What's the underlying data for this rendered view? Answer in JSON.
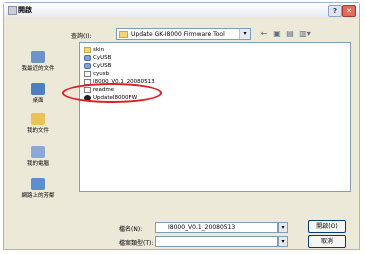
{
  "window": {
    "title": "開啟"
  },
  "titlebar": {
    "help": "?",
    "close": "✕"
  },
  "toolbar": {
    "look_in_label": "查詢(I):",
    "look_in_value": "Update GK-I8000 Firmware Tool",
    "dropdown_arrow": "▾",
    "back": "←",
    "up": "▣",
    "new_folder": "▤",
    "views": "▥▾"
  },
  "places": [
    {
      "label": "我最近的文件",
      "icon": "recent-documents-icon",
      "color": "#6d93c8"
    },
    {
      "label": "桌面",
      "icon": "desktop-icon",
      "color": "#4f7fc0"
    },
    {
      "label": "我的文件",
      "icon": "my-documents-icon",
      "color": "#e9c25a"
    },
    {
      "label": "我的電腦",
      "icon": "my-computer-icon",
      "color": "#8aa9d6"
    },
    {
      "label": "網路上的芳鄰",
      "icon": "network-places-icon",
      "color": "#5c8fd0"
    }
  ],
  "files": [
    {
      "name": "skin",
      "icon": "folder-icon"
    },
    {
      "name": "CyUSB",
      "icon": "usb-driver-icon"
    },
    {
      "name": "CyUSB",
      "icon": "usb-driver-icon"
    },
    {
      "name": "cyusb",
      "icon": "file-icon"
    },
    {
      "name": "I8000_V0.1_20080513",
      "icon": "file-icon"
    },
    {
      "name": "readme",
      "icon": "file-icon"
    },
    {
      "name": "UpdateI8000FW",
      "icon": "exe-icon"
    }
  ],
  "filename": {
    "label": "檔名(N):",
    "value": "I8000_V0.1_20080513"
  },
  "filetype": {
    "label": "檔案類型(T):",
    "value": ""
  },
  "buttons": {
    "open": "開啟(O)",
    "cancel": "取消"
  },
  "colors": {
    "highlight": "#e31c23",
    "dialog_bg": "#ECE9D8",
    "close_button": "#e46a5b"
  }
}
